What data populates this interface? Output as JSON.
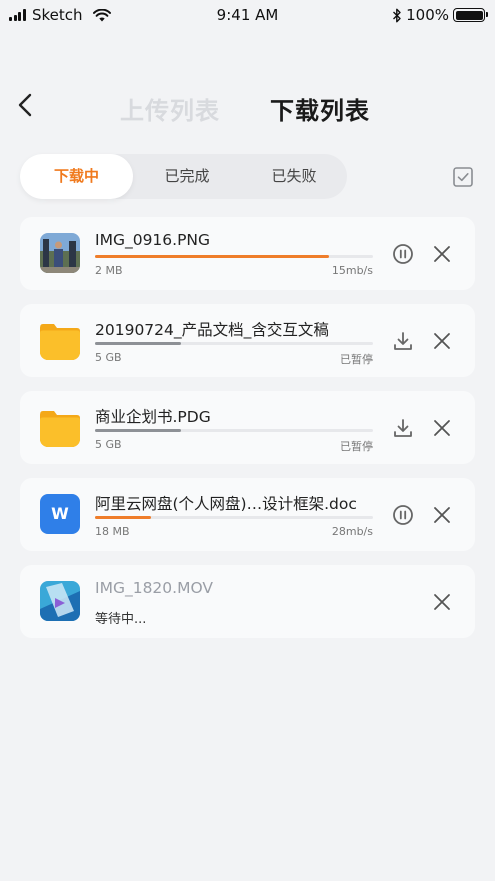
{
  "status": {
    "carrier": "Sketch",
    "time": "9:41 AM",
    "battery": "100%"
  },
  "nav": {
    "upload_tab": "上传列表",
    "download_tab": "下载列表"
  },
  "filters": {
    "downloading": "下载中",
    "completed": "已完成",
    "failed": "已失败"
  },
  "colors": {
    "accent": "#f07a1e",
    "background": "#f2f3f5",
    "word_blue": "#2f7fe8",
    "folder_yellow": "#fbbf2a"
  },
  "items": [
    {
      "name": "IMG_0916.PNG",
      "size": "2 MB",
      "status": "15mb/s",
      "progress": 0.84,
      "progress_color": "orange",
      "icon": "photo-thumbnail",
      "action": "pause-icon"
    },
    {
      "name": "20190724_产品文档_含交互文稿",
      "size": "5 GB",
      "status": "已暂停",
      "progress": 0.31,
      "progress_color": "gray",
      "icon": "folder-icon",
      "action": "download-icon"
    },
    {
      "name": "商业企划书.PDG",
      "size": "5 GB",
      "status": "已暂停",
      "progress": 0.31,
      "progress_color": "gray",
      "icon": "folder-icon",
      "action": "download-icon"
    },
    {
      "name": "阿里云网盘(个人网盘)…设计框架.doc",
      "size": "18 MB",
      "status": "28mb/s",
      "progress": 0.2,
      "progress_color": "orange",
      "icon": "word-doc-icon",
      "icon_letter": "W",
      "action": "pause-icon"
    },
    {
      "name": "IMG_1820.MOV",
      "status": "等待中...",
      "icon": "video-thumbnail"
    }
  ]
}
